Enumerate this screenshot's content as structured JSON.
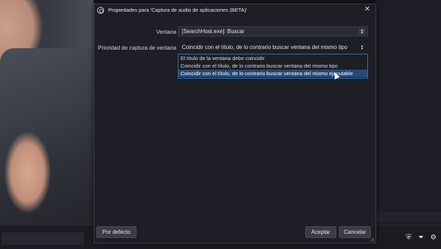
{
  "dialog": {
    "title": "Propiedades para 'Captura de audio de aplicaciones (BETA)'",
    "close_label": "✕"
  },
  "form": {
    "window_label": "Ventana",
    "window_value": "[SearchHost.exe]: Buscar",
    "priority_label": "Prioridad de captura de ventana",
    "priority_value": "Coincidir con el título, de lo contrario buscar ventana del mismo tipo",
    "priority_options": [
      "El título de la ventana debe coincidir",
      "Coincidir con el título, de lo contrario buscar ventana del mismo tipo",
      "Coincidir con el título, de lo contrario buscar ventana del mismo ejecutable"
    ],
    "priority_highlighted_index": 2
  },
  "buttons": {
    "defaults": "Por defecto",
    "ok": "Aceptar",
    "cancel": "Cancelar"
  },
  "icons": {
    "bottom_bar": [
      "shield-icon",
      "filter-icon",
      "settings-icon"
    ]
  }
}
